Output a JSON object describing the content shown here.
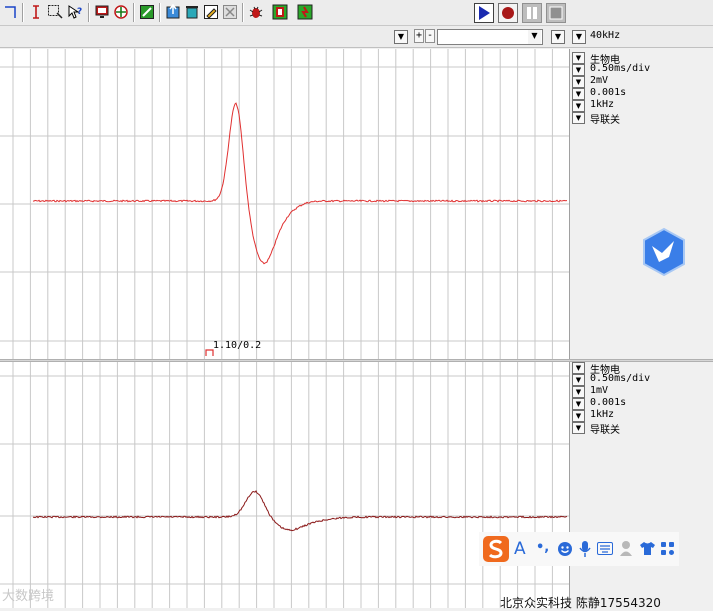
{
  "toolbar": {
    "icons": [
      "cursor-icon",
      "text-cursor-icon",
      "select-region-icon",
      "help-icon",
      "monitor-icon",
      "add-channel-icon",
      "edit-icon",
      "export-icon",
      "delete-icon",
      "pencil-icon",
      "clear-icon",
      "bug-icon",
      "stimulator-icon",
      "run-icon"
    ],
    "run_controls": [
      "play-icon",
      "record-icon",
      "pause-icon",
      "stop-icon"
    ]
  },
  "top_bar": {
    "plus_label": "+",
    "minus_label": "-",
    "combo_value": "",
    "sampling_rate": "40kHz"
  },
  "channel1": {
    "params": [
      "生物电",
      "0.50ms/div",
      "2mV",
      "0.001s",
      "1kHz",
      "导联关"
    ],
    "marker_label": "1.10/0.2"
  },
  "channel2": {
    "params": [
      "生物电",
      "0.50ms/div",
      "1mV",
      "0.001s",
      "1kHz",
      "导联关"
    ]
  },
  "ime_toolbar": {
    "letter": "A",
    "punct": "•,"
  },
  "footer_text": "北京众实科技 陈静17554320",
  "watermark_text": "大数跨境",
  "colors": {
    "trace1": "#e03030",
    "trace2": "#8a1818",
    "grid": "#c8c8c8",
    "app_icon": "#3a7ee8"
  }
}
